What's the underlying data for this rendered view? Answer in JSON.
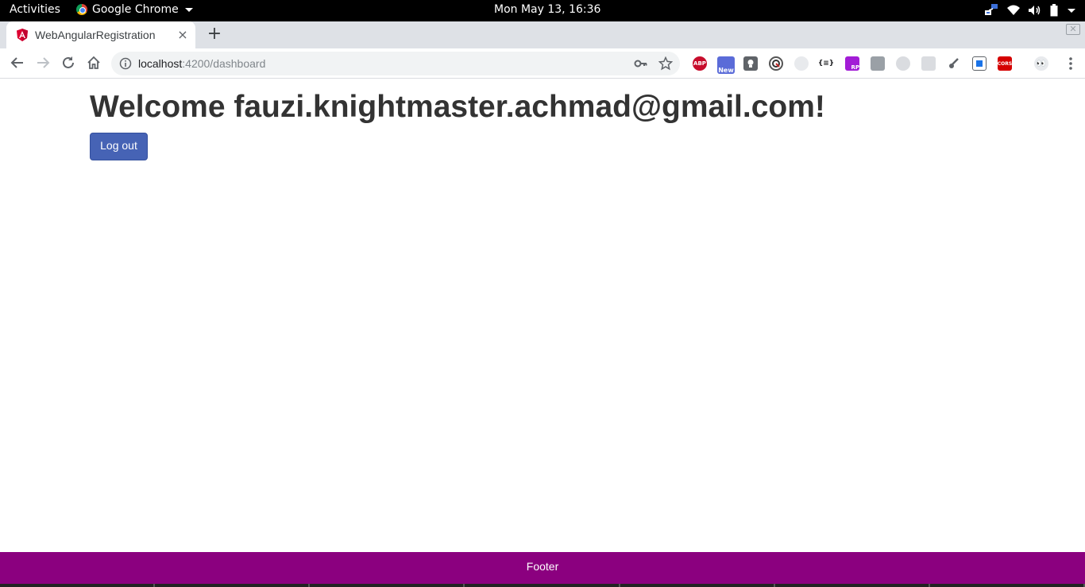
{
  "system": {
    "activities": "Activities",
    "app_name": "Google Chrome",
    "clock": "Mon May 13, 16:36"
  },
  "browser": {
    "tab_title": "WebAngularRegistration",
    "url_host": "localhost",
    "url_path": ":4200/dashboard",
    "new_tab_label": "+",
    "tab_close_label": "×",
    "extensions": {
      "abp": "ABP",
      "new_badge": "New",
      "json": "{≡}",
      "rp": "RP",
      "cors": "CORS"
    }
  },
  "page": {
    "welcome_prefix": "Welcome ",
    "user_email": "fauzi.knightmaster.achmad@gmail.com!",
    "logout_label": "Log out",
    "footer_text": "Footer"
  },
  "colors": {
    "accent_button": "#4663b5",
    "footer_bg": "#8b007f"
  }
}
